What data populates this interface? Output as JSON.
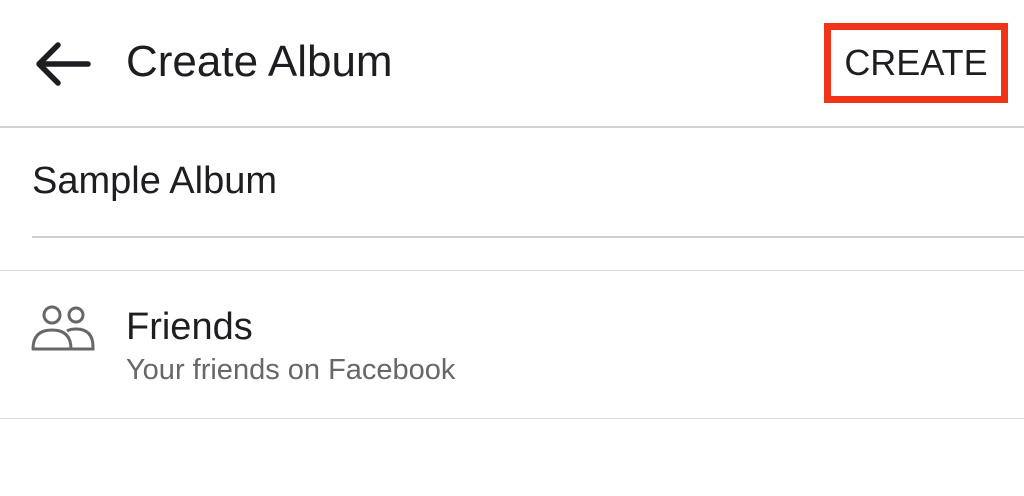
{
  "header": {
    "title": "Create Album",
    "create_label": "CREATE",
    "back_icon": "arrow-left-icon",
    "highlight_color": "#f0341a"
  },
  "album": {
    "name_value": "Sample Album"
  },
  "privacy": {
    "icon": "friends-icon",
    "label": "Friends",
    "description": "Your friends on Facebook"
  }
}
